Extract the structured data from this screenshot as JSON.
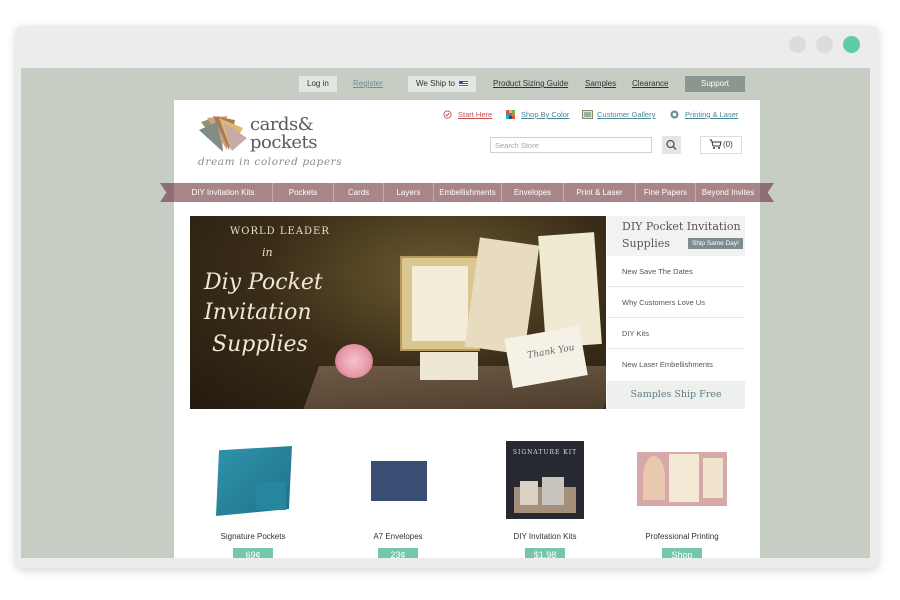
{
  "topbar": {
    "login": "Log in",
    "register": "Register",
    "we_ship_to": "We Ship to",
    "links": [
      "Product Sizing Guide",
      "Samples",
      "Clearance"
    ],
    "support": "Support"
  },
  "logo": {
    "line1": "cards&",
    "line2": "pockets",
    "tagline": "dream in colored papers"
  },
  "header_links": [
    {
      "label": "Start Here",
      "icon": "check-circle-icon"
    },
    {
      "label": "Shop By Color",
      "icon": "color-grid-icon"
    },
    {
      "label": "Customer Gallery",
      "icon": "gallery-icon"
    },
    {
      "label": "Printing & Laser",
      "icon": "printing-icon"
    }
  ],
  "search": {
    "placeholder": "Search Store"
  },
  "cart": {
    "count": "(0)"
  },
  "nav": [
    "DIY Invitation Kits",
    "Pockets",
    "Cards",
    "Layers",
    "Embellishments",
    "Envelopes",
    "Print & Laser",
    "Fine Papers",
    "Beyond Invites"
  ],
  "hero": {
    "line1": "WORLD LEADER",
    "line2": "in",
    "script1": "Diy Pocket",
    "script2": "Invitation",
    "script3": "Supplies",
    "card_text": "Thank You"
  },
  "side": {
    "title": "DIY Pocket Invitation Supplies",
    "badge": "Ship Same Day!",
    "items": [
      "New Save The Dates",
      "Why Customers Love Us",
      "DIY Kits",
      "New Laser Embellishments"
    ],
    "footer": "Samples Ship Free"
  },
  "products": [
    {
      "name": "Signature Pockets",
      "price": "69¢"
    },
    {
      "name": "A7 Envelopes",
      "price": "23¢"
    },
    {
      "name": "DIY Invitation Kits",
      "price": "$1.98",
      "kit_label": "SIGNATURE KIT"
    },
    {
      "name": "Professional Printing",
      "price": "Shop"
    }
  ],
  "colors": {
    "accent": "#74c7a9",
    "nav": "#a88589",
    "link": "#4a8596",
    "background": "#c5ccc2"
  }
}
